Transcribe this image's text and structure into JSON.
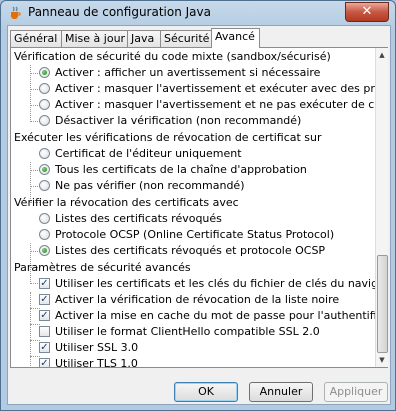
{
  "window": {
    "title": "Panneau de configuration Java",
    "close_label": "✕"
  },
  "tabs": [
    {
      "label": "Général",
      "active": false
    },
    {
      "label": "Mise à jour",
      "active": false
    },
    {
      "label": "Java",
      "active": false
    },
    {
      "label": "Sécurité",
      "active": false
    },
    {
      "label": "Avancé",
      "active": true
    }
  ],
  "settings": {
    "group1": {
      "title": "Vérification de sécurité du code mixte (sandbox/sécurisé)",
      "options": [
        {
          "label": "Activer : afficher un avertissement si nécessaire",
          "selected": true
        },
        {
          "label": "Activer : masquer l'avertissement et exécuter avec des protections",
          "selected": false
        },
        {
          "label": "Activer : masquer l'avertissement et ne pas exécuter de code non sécurisé",
          "selected": false
        },
        {
          "label": "Désactiver la vérification (non recommandé)",
          "selected": false
        }
      ]
    },
    "group2": {
      "title": "Exécuter les vérifications de révocation de certificat sur",
      "options": [
        {
          "label": "Certificat de l'éditeur uniquement",
          "selected": false
        },
        {
          "label": "Tous les certificats de la chaîne d'approbation",
          "selected": true
        },
        {
          "label": "Ne pas vérifier (non recommandé)",
          "selected": false
        }
      ]
    },
    "group3": {
      "title": "Vérifier la révocation des certificats avec",
      "options": [
        {
          "label": "Listes des certificats révoqués",
          "selected": false
        },
        {
          "label": "Protocole OCSP (Online Certificate Status Protocol)",
          "selected": false
        },
        {
          "label": "Listes des certificats révoqués et protocole OCSP",
          "selected": true
        }
      ]
    },
    "group4": {
      "title": "Paramètres de sécurité avancés",
      "options": [
        {
          "label": "Utiliser les certificats et les clés du fichier de clés du navigateur",
          "checked": true
        },
        {
          "label": "Activer la vérification de révocation de la liste noire",
          "checked": true
        },
        {
          "label": "Activer la mise en cache du mot de passe pour l'authentification",
          "checked": true
        },
        {
          "label": "Utiliser le format ClientHello compatible SSL 2.0",
          "checked": false
        },
        {
          "label": "Utiliser SSL 3.0",
          "checked": true
        },
        {
          "label": "Utiliser TLS 1.0",
          "checked": true
        }
      ]
    }
  },
  "buttons": {
    "ok": "OK",
    "cancel": "Annuler",
    "apply": "Appliquer"
  },
  "icons": {
    "app": "java-cup-icon",
    "check": "checkmark-icon"
  },
  "colors": {
    "selected_radio": "#1d7a1d",
    "check": "#1a3e7a"
  }
}
